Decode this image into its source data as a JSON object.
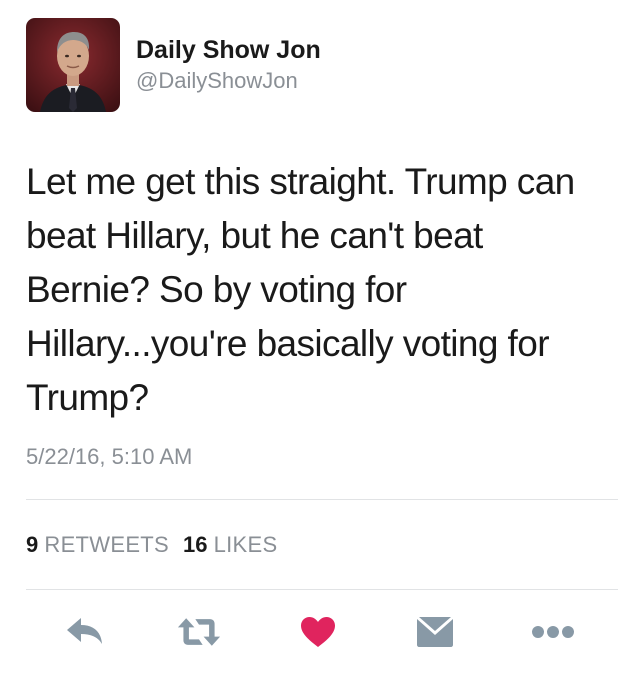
{
  "user": {
    "display_name": "Daily Show Jon",
    "handle": "@DailyShowJon"
  },
  "tweet": {
    "lines": [
      "Let me get this straight. Trump can",
      "beat Hillary, but he can't beat",
      "Bernie? So by voting for",
      "Hillary...you're basically voting for",
      "Trump?"
    ],
    "timestamp": "5/22/16, 5:10 AM"
  },
  "stats": {
    "retweets_count": "9",
    "retweets_label": "RETWEETS",
    "likes_count": "16",
    "likes_label": "LIKES"
  },
  "actions": {
    "reply_icon": "reply-icon",
    "retweet_icon": "retweet-icon",
    "like_icon": "heart-icon",
    "message_icon": "envelope-icon",
    "more_icon": "more-icon"
  },
  "colors": {
    "text": "#1a1a1a",
    "muted": "#8a8f95",
    "icon": "#8899a6",
    "like": "#e0245e",
    "avatar_bg": "#5c1a1f"
  }
}
